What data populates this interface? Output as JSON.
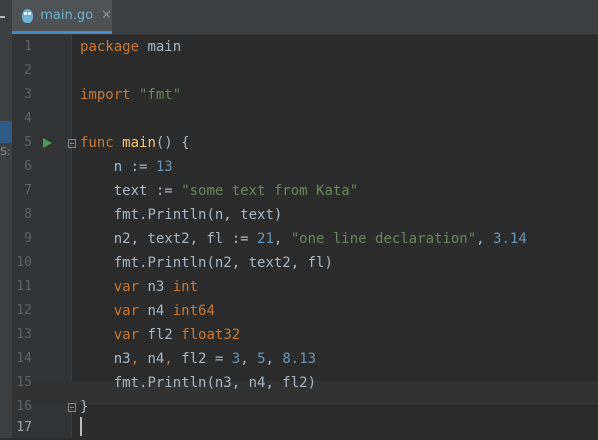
{
  "tab": {
    "label": "main.go",
    "close_glyph": "✕",
    "icon": "gopher-icon"
  },
  "left_panel_fragment": "S:",
  "lines": [
    {
      "n": "1"
    },
    {
      "n": "2"
    },
    {
      "n": "3"
    },
    {
      "n": "4"
    },
    {
      "n": "5"
    },
    {
      "n": "6"
    },
    {
      "n": "7"
    },
    {
      "n": "8"
    },
    {
      "n": "9"
    },
    {
      "n": "10"
    },
    {
      "n": "11"
    },
    {
      "n": "12"
    },
    {
      "n": "13"
    },
    {
      "n": "14"
    },
    {
      "n": "15"
    },
    {
      "n": "16"
    },
    {
      "n": "17"
    }
  ],
  "code": {
    "l1": [
      "package",
      " main"
    ],
    "l3": [
      "import",
      " \"fmt\""
    ],
    "l5": [
      "func",
      " ",
      "main",
      "() {"
    ],
    "l6": [
      "    n := ",
      "13"
    ],
    "l7": [
      "    text := ",
      "\"some text from Kata\""
    ],
    "l8": [
      "    ",
      "fmt",
      ".Println(n, text)"
    ],
    "l9": [
      "    n2, text2, fl := ",
      "21",
      ", ",
      "\"one line declaration\"",
      ", ",
      "3.14"
    ],
    "l10": [
      "    ",
      "fmt",
      ".Println(n2, text2, fl)"
    ],
    "l11": [
      "    ",
      "var",
      " n3 ",
      "int"
    ],
    "l12": [
      "    ",
      "var",
      " n4 ",
      "int64"
    ],
    "l13": [
      "    ",
      "var",
      " fl2 ",
      "float32"
    ],
    "l14": [
      "    n3",
      ",",
      " n4",
      ",",
      " fl2 = ",
      "3",
      ", ",
      "5",
      ", ",
      "8.13"
    ],
    "l15": [
      "    ",
      "fmt",
      ".Println(n3, n4, fl2)"
    ],
    "l16": [
      "}"
    ]
  },
  "colors": {
    "keyword": "#cc7832",
    "string": "#6a8759",
    "number": "#6897bb",
    "function": "#ffc66d",
    "text": "#a9b7c6",
    "run": "#499c54"
  }
}
